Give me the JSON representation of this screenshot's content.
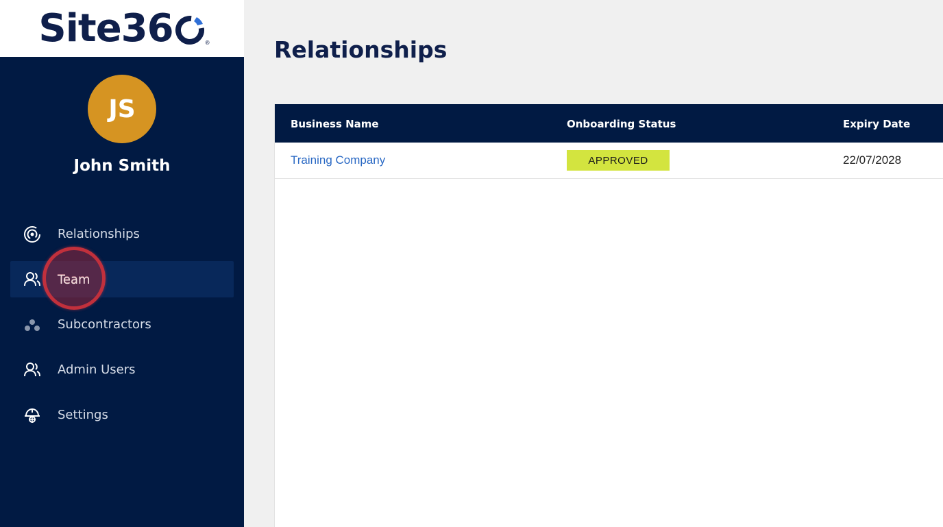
{
  "brand": {
    "logo_text": "Site36",
    "logo_reg": "®"
  },
  "user": {
    "initials": "JS",
    "name": "John Smith"
  },
  "nav": {
    "items": [
      {
        "label": "Relationships",
        "icon": "relationships-icon"
      },
      {
        "label": "Team",
        "icon": "team-icon",
        "active": true
      },
      {
        "label": "Subcontractors",
        "icon": "subcontractors-icon"
      },
      {
        "label": "Admin Users",
        "icon": "admin-users-icon"
      },
      {
        "label": "Settings",
        "icon": "settings-icon"
      }
    ]
  },
  "main": {
    "title": "Relationships",
    "table": {
      "columns": [
        "Business Name",
        "Onboarding Status",
        "Expiry Date"
      ],
      "rows": [
        {
          "business_name": "Training Company",
          "status": "APPROVED",
          "expiry": "22/07/2028"
        }
      ]
    }
  },
  "colors": {
    "sidebar_bg": "#011a43",
    "active_item_bg": "#08285a",
    "avatar_bg": "#d69422",
    "approved_badge": "#d3e43f",
    "link": "#2a69c4",
    "brand_navy": "#0f1f4b"
  }
}
